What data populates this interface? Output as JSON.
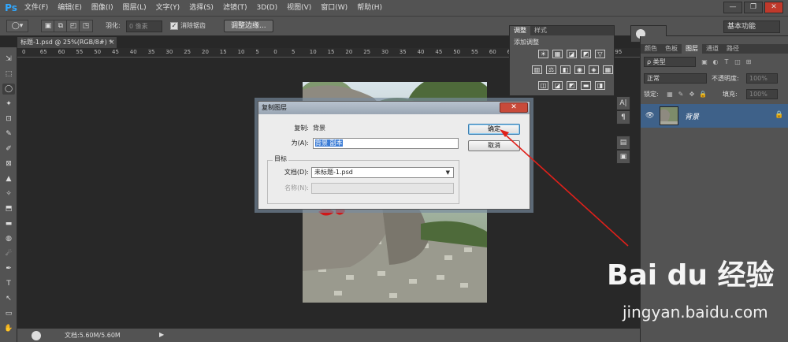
{
  "app": {
    "logo": "Ps",
    "menu": [
      "文件(F)",
      "编辑(E)",
      "图像(I)",
      "图层(L)",
      "文字(Y)",
      "选择(S)",
      "滤镜(T)",
      "3D(D)",
      "视图(V)",
      "窗口(W)",
      "帮助(H)"
    ],
    "window_buttons": [
      "—",
      "❐",
      "✕"
    ]
  },
  "options": {
    "feather_label": "羽化:",
    "feather_value": "0 像素",
    "antialias_label": "消除锯齿",
    "refine_edge": "调整边缘...",
    "workspace": "基本功能"
  },
  "document": {
    "tab": "标题-1.psd @ 25%(RGB/8#) *",
    "tab_close": "×",
    "ruler_ticks": [
      "0",
      "65",
      "60",
      "55",
      "50",
      "45",
      "40",
      "35",
      "30",
      "25",
      "20",
      "15",
      "10",
      "5",
      "0",
      "5",
      "10",
      "15",
      "20",
      "25",
      "30",
      "35",
      "40",
      "45",
      "50",
      "55",
      "60",
      "65",
      "70",
      "75",
      "80",
      "85",
      "90",
      "95"
    ],
    "status": "文档:5.60M/5.60M",
    "status_arrow": "▶"
  },
  "tools": [
    "⇲",
    "⬚",
    "◯",
    "✦",
    "⊡",
    "✎",
    "✐",
    "⊠",
    "▲",
    "✧",
    "⬒",
    "▬",
    "◍",
    "☄",
    "✒",
    "T",
    "↖",
    "▭",
    "✋"
  ],
  "adjustments": {
    "tabs": [
      "调整",
      "样式"
    ],
    "title": "添加调整",
    "icons_row1": [
      "☀",
      "▦",
      "◪",
      "◩",
      "▽"
    ],
    "icons_row2": [
      "▥",
      "⚖",
      "◧",
      "◉",
      "◈",
      "▦"
    ],
    "icons_row3": [
      "◫",
      "◪",
      "◩",
      "▬",
      "◨"
    ]
  },
  "dock": [
    "A|",
    "¶",
    "▤",
    "▣"
  ],
  "layers": {
    "tabs": [
      "颜色",
      "色板",
      "图层",
      "通道",
      "路径"
    ],
    "filter_type": "ρ 类型",
    "blend_mode": "正常",
    "opacity_label": "不透明度:",
    "opacity_value": "100%",
    "lock_label": "锁定:",
    "fill_label": "填充:",
    "fill_value": "100%",
    "layer_name": "背景"
  },
  "dialog": {
    "title": "复制图层",
    "close": "✕",
    "copy_label": "复制:",
    "copy_value": "背景",
    "as_label": "为(A):",
    "as_value": "背景 副本",
    "target_group": "目标",
    "doc_label": "文档(D):",
    "doc_value": "未标题-1.psd",
    "name_label": "名称(N):",
    "ok": "确定",
    "cancel": "取消"
  },
  "watermark": {
    "main": "Bai du 经验",
    "sub": "jingyan.baidu.com"
  },
  "colors": {
    "chrome": "#535353",
    "workspace": "#282828",
    "selection": "#3a7bd5",
    "annotation_arrow": "#e0201a"
  }
}
